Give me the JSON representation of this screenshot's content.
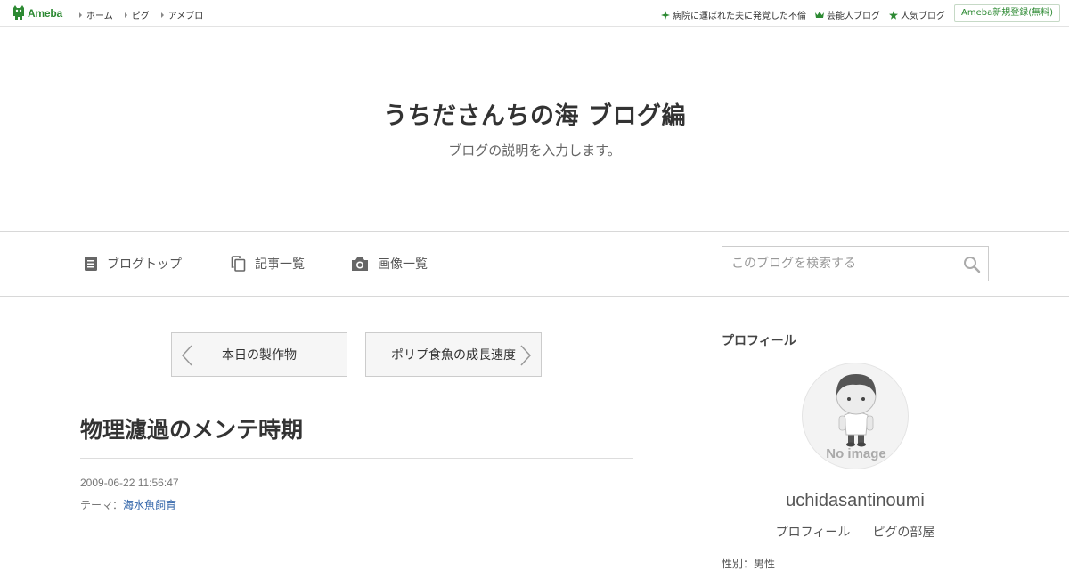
{
  "topbar": {
    "logo_text": "Ameba",
    "nav": [
      {
        "label": "ホーム"
      },
      {
        "label": "ピグ"
      },
      {
        "label": "アメブロ"
      }
    ],
    "links": [
      {
        "label": "病院に運ばれた夫に発覚した不倫",
        "icon": "sparkle-icon"
      },
      {
        "label": "芸能人ブログ",
        "icon": "crown-icon"
      },
      {
        "label": "人気ブログ",
        "icon": "star-icon"
      }
    ],
    "signup_label": "Ameba新規登録(無料)"
  },
  "header": {
    "title": "うちださんちの海 ブログ編",
    "description": "ブログの説明を入力します。"
  },
  "gnav": {
    "items": [
      {
        "label": "ブログトップ",
        "icon": "document-icon"
      },
      {
        "label": "記事一覧",
        "icon": "copy-icon"
      },
      {
        "label": "画像一覧",
        "icon": "camera-icon"
      }
    ],
    "search_placeholder": "このブログを検索する"
  },
  "pager": {
    "prev_label": "本日の製作物",
    "next_label": "ポリプ食魚の成長速度"
  },
  "entry": {
    "title": "物理濾過のメンテ時期",
    "date": "2009-06-22 11:56:47",
    "theme_prefix": "テーマ：",
    "theme_link": "海水魚飼育"
  },
  "sidebar": {
    "heading": "プロフィール",
    "avatar_caption": "No image",
    "name": "uchidasantinoumi",
    "links": [
      {
        "label": "プロフィール"
      },
      {
        "label": "ピグの部屋"
      }
    ],
    "cut_text": "性別：男性"
  },
  "colors": {
    "ameba_green": "#2d8a33",
    "link_blue": "#3366aa",
    "border_gray": "#cccccc"
  }
}
